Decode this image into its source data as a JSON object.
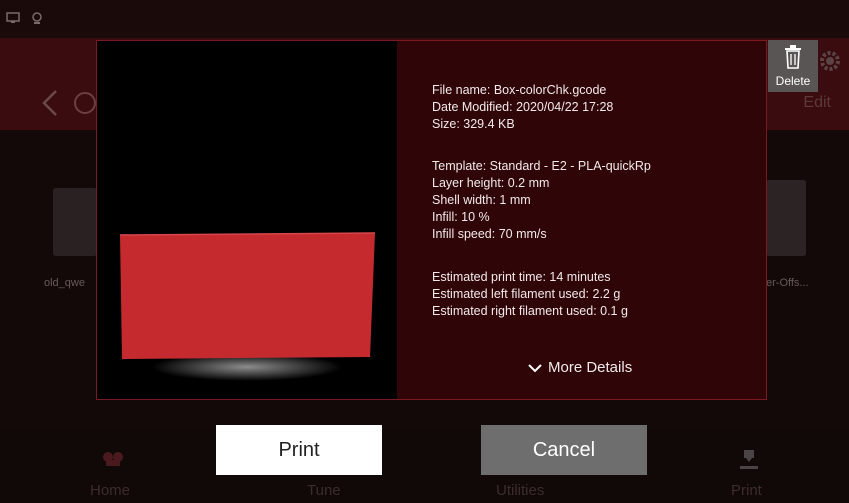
{
  "background": {
    "header": {
      "edit_label": "Edit"
    },
    "files": [
      {
        "label": "old_qwe"
      },
      {
        "label": "er-Offs..."
      }
    ],
    "nav": [
      {
        "label": "Home",
        "icon": "home-icon"
      },
      {
        "label": "Tune",
        "icon": "tune-icon"
      },
      {
        "label": "Utilities",
        "icon": "utilities-icon"
      },
      {
        "label": "Print",
        "icon": "print-icon"
      }
    ]
  },
  "dialog": {
    "file_info": [
      "File name: Box-colorChk.gcode",
      "Date Modified: 2020/04/22 17:28",
      "Size: 329.4 KB"
    ],
    "print_settings": [
      "Template: Standard - E2 - PLA-quickRp",
      "Layer height: 0.2 mm",
      "Shell width: 1 mm",
      "Infill: 10 %",
      "Infill speed: 70 mm/s"
    ],
    "estimates": [
      "Estimated print time: 14 minutes",
      "Estimated left filament used: 2.2 g",
      "Estimated right filament used: 0.1 g"
    ],
    "more_details_label": "More Details",
    "delete_label": "Delete"
  },
  "actions": {
    "print_label": "Print",
    "cancel_label": "Cancel"
  },
  "colors": {
    "accent": "#7a1a1f",
    "model": "#c42a2e",
    "info_bg": "#2f0508"
  }
}
